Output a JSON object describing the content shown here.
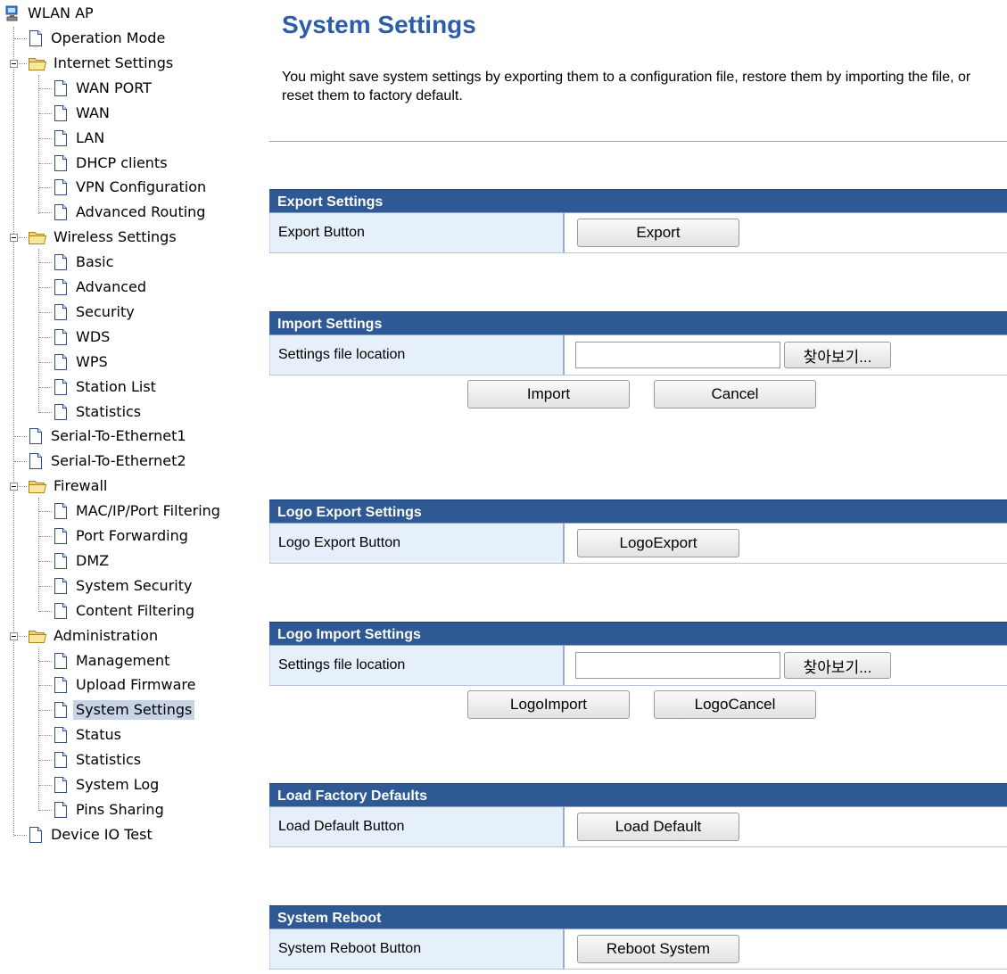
{
  "tree": {
    "root": "WLAN AP",
    "items": [
      {
        "label": "Operation Mode"
      },
      {
        "label": "Internet Settings"
      },
      {
        "label": "WAN PORT"
      },
      {
        "label": "WAN"
      },
      {
        "label": "LAN"
      },
      {
        "label": "DHCP clients"
      },
      {
        "label": "VPN Configuration"
      },
      {
        "label": "Advanced Routing"
      },
      {
        "label": "Wireless Settings"
      },
      {
        "label": "Basic"
      },
      {
        "label": "Advanced"
      },
      {
        "label": "Security"
      },
      {
        "label": "WDS"
      },
      {
        "label": "WPS"
      },
      {
        "label": "Station List"
      },
      {
        "label": "Statistics"
      },
      {
        "label": "Serial-To-Ethernet1"
      },
      {
        "label": "Serial-To-Ethernet2"
      },
      {
        "label": "Firewall"
      },
      {
        "label": "MAC/IP/Port Filtering"
      },
      {
        "label": "Port Forwarding"
      },
      {
        "label": "DMZ"
      },
      {
        "label": "System Security"
      },
      {
        "label": "Content Filtering"
      },
      {
        "label": "Administration"
      },
      {
        "label": "Management"
      },
      {
        "label": "Upload Firmware"
      },
      {
        "label": "System Settings"
      },
      {
        "label": "Status"
      },
      {
        "label": "Statistics"
      },
      {
        "label": "System Log"
      },
      {
        "label": "Pins Sharing"
      },
      {
        "label": "Device IO Test"
      }
    ],
    "selected": "System Settings"
  },
  "page": {
    "title": "System Settings",
    "intro": "You might save system settings by exporting them to a configuration file, restore them by importing the file, or reset them to factory default."
  },
  "export": {
    "header": "Export Settings",
    "label": "Export Button",
    "button": "Export"
  },
  "import": {
    "header": "Import Settings",
    "label": "Settings file location",
    "file_value": "",
    "browse": "찾아보기...",
    "import_button": "Import",
    "cancel_button": "Cancel"
  },
  "logo_export": {
    "header": "Logo Export Settings",
    "label": "Logo Export Button",
    "button": "LogoExport"
  },
  "logo_import": {
    "header": "Logo Import Settings",
    "label": "Settings file location",
    "file_value": "",
    "browse": "찾아보기...",
    "import_button": "LogoImport",
    "cancel_button": "LogoCancel"
  },
  "factory": {
    "header": "Load Factory Defaults",
    "label": "Load Default Button",
    "button": "Load Default"
  },
  "reboot": {
    "header": "System Reboot",
    "label": "System Reboot Button",
    "button": "Reboot System"
  },
  "colors": {
    "accent_title": "#2b5ea7",
    "section_header": "#2e5994",
    "label_cell": "#e6f0fb",
    "selected_node": "#c7d4e8"
  }
}
